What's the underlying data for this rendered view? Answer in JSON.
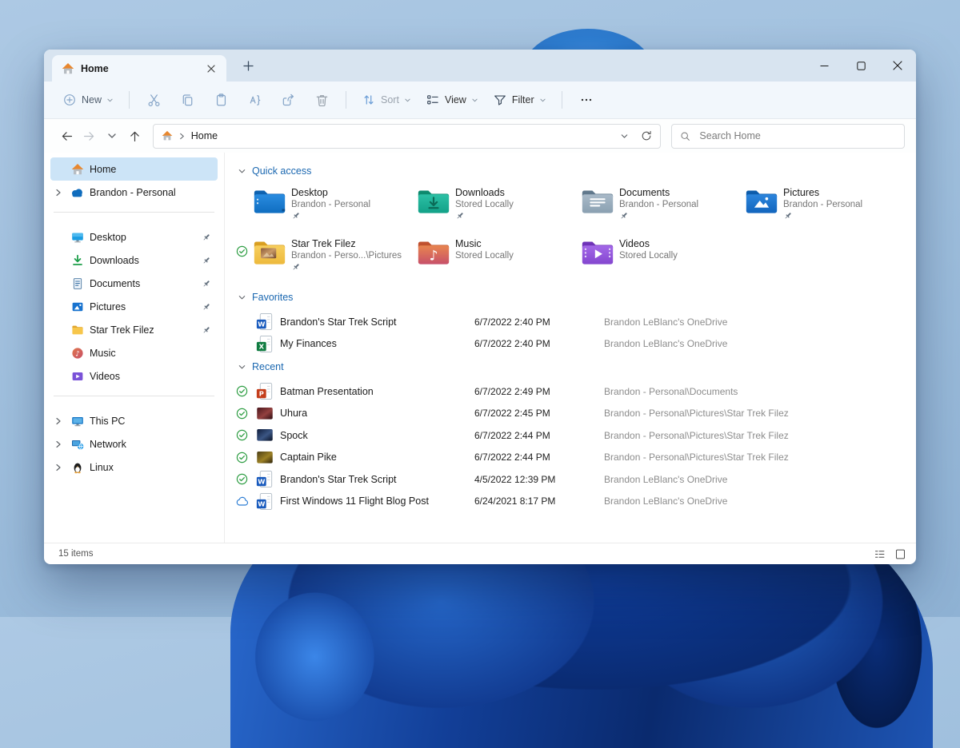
{
  "window": {
    "tab_title": "Home",
    "controls": {
      "minimize": "minimize",
      "maximize": "maximize",
      "close": "close"
    }
  },
  "toolbar": {
    "new_label": "New",
    "sort_label": "Sort",
    "view_label": "View",
    "filter_label": "Filter",
    "icon_buttons": [
      "cut",
      "copy",
      "paste",
      "rename",
      "share",
      "delete"
    ]
  },
  "address": {
    "breadcrumb": "Home",
    "search_placeholder": "Search Home"
  },
  "sidebar": {
    "top": [
      {
        "label": "Home",
        "icon": "home",
        "selected": true,
        "chevron": false
      },
      {
        "label": "Brandon - Personal",
        "icon": "onedrive",
        "selected": false,
        "chevron": true
      }
    ],
    "pinned": [
      {
        "label": "Desktop",
        "icon": "desktop",
        "pinned": true
      },
      {
        "label": "Downloads",
        "icon": "downloads",
        "pinned": true
      },
      {
        "label": "Documents",
        "icon": "documents",
        "pinned": true
      },
      {
        "label": "Pictures",
        "icon": "pictures",
        "pinned": true
      },
      {
        "label": "Star Trek Filez",
        "icon": "folder",
        "pinned": true
      },
      {
        "label": "Music",
        "icon": "music",
        "pinned": false
      },
      {
        "label": "Videos",
        "icon": "videos",
        "pinned": false
      }
    ],
    "bottom": [
      {
        "label": "This PC",
        "icon": "thispc",
        "chevron": true
      },
      {
        "label": "Network",
        "icon": "network",
        "chevron": true
      },
      {
        "label": "Linux",
        "icon": "linux",
        "chevron": true
      }
    ]
  },
  "sections": {
    "quick_access": {
      "title": "Quick access",
      "items": [
        {
          "name": "Desktop",
          "subtitle": "Brandon - Personal",
          "icon": "folder-desktop",
          "pinned": true,
          "synced": false
        },
        {
          "name": "Downloads",
          "subtitle": "Stored Locally",
          "icon": "folder-downloads",
          "pinned": true,
          "synced": false
        },
        {
          "name": "Documents",
          "subtitle": "Brandon - Personal",
          "icon": "folder-documents",
          "pinned": true,
          "synced": false
        },
        {
          "name": "Pictures",
          "subtitle": "Brandon - Personal",
          "icon": "folder-pictures",
          "pinned": true,
          "synced": false
        },
        {
          "name": "Star Trek Filez",
          "subtitle": "Brandon - Perso...\\Pictures",
          "icon": "folder-startrek",
          "pinned": true,
          "synced": true
        },
        {
          "name": "Music",
          "subtitle": "Stored Locally",
          "icon": "folder-music",
          "pinned": false,
          "synced": false
        },
        {
          "name": "Videos",
          "subtitle": "Stored Locally",
          "icon": "folder-videos",
          "pinned": false,
          "synced": false
        }
      ]
    },
    "favorites": {
      "title": "Favorites",
      "items": [
        {
          "name": "Brandon's Star Trek Script",
          "icon": "word",
          "status": "none",
          "date": "6/7/2022 2:40 PM",
          "location": "Brandon LeBlanc's OneDrive"
        },
        {
          "name": "My Finances",
          "icon": "excel",
          "status": "none",
          "date": "6/7/2022 2:40 PM",
          "location": "Brandon LeBlanc's OneDrive"
        }
      ]
    },
    "recent": {
      "title": "Recent",
      "items": [
        {
          "name": "Batman Presentation",
          "icon": "powerpoint",
          "status": "synced",
          "date": "6/7/2022 2:49 PM",
          "location": "Brandon - Personal\\Documents"
        },
        {
          "name": "Uhura",
          "icon": "thumb-red",
          "status": "synced",
          "date": "6/7/2022 2:45 PM",
          "location": "Brandon - Personal\\Pictures\\Star Trek Filez"
        },
        {
          "name": "Spock",
          "icon": "thumb-blue",
          "status": "synced",
          "date": "6/7/2022 2:44 PM",
          "location": "Brandon - Personal\\Pictures\\Star Trek Filez"
        },
        {
          "name": "Captain Pike",
          "icon": "thumb-olive",
          "status": "synced",
          "date": "6/7/2022 2:44 PM",
          "location": "Brandon - Personal\\Pictures\\Star Trek Filez"
        },
        {
          "name": "Brandon's Star Trek Script",
          "icon": "word",
          "status": "synced",
          "date": "4/5/2022 12:39 PM",
          "location": "Brandon LeBlanc's OneDrive"
        },
        {
          "name": "First Windows 11 Flight Blog Post",
          "icon": "word",
          "status": "cloud",
          "date": "6/24/2021 8:17 PM",
          "location": "Brandon LeBlanc's OneDrive"
        }
      ]
    }
  },
  "statusbar": {
    "items_text": "15 items"
  },
  "colors": {
    "accent": "#0f6cbd",
    "section_header": "#1a67b0",
    "selected_sidebar": "#cce4f7",
    "sync_green": "#2f9e44",
    "cloud_blue": "#2b7cd3"
  }
}
